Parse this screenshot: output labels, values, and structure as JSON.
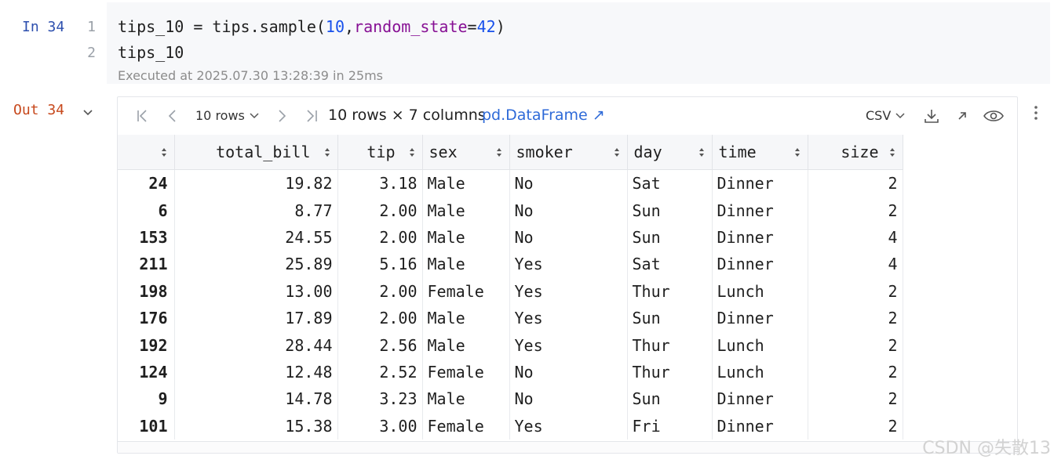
{
  "input_cell": {
    "prompt": "In 34",
    "line_numbers": [
      "1",
      "2"
    ],
    "line1": {
      "var": "tips_10 = tips.sample(",
      "arg1": "10",
      "comma": ",",
      "kw": "random_state",
      "eq": "=",
      "arg2": "42",
      "close": ")"
    },
    "line2": "tips_10",
    "executed": "Executed at 2025.07.30 13:28:39 in 25ms"
  },
  "output_cell": {
    "prompt": "Out 34",
    "toolbar": {
      "rows_select": "10 rows",
      "summary": "10 rows × 7 columns",
      "type_link": "pd.DataFrame ↗",
      "csv_select": "CSV",
      "icons": [
        "first-page-icon",
        "prev-page-icon",
        "next-page-icon",
        "last-page-icon",
        "download-icon",
        "open-external-icon",
        "eye-icon",
        "more-vertical-icon"
      ]
    },
    "table": {
      "columns": [
        "",
        "total_bill",
        "tip",
        "sex",
        "smoker",
        "day",
        "time",
        "size"
      ],
      "rows": [
        [
          "24",
          "19.82",
          "3.18",
          "Male",
          "No",
          "Sat",
          "Dinner",
          "2"
        ],
        [
          "6",
          "8.77",
          "2.00",
          "Male",
          "No",
          "Sun",
          "Dinner",
          "2"
        ],
        [
          "153",
          "24.55",
          "2.00",
          "Male",
          "No",
          "Sun",
          "Dinner",
          "4"
        ],
        [
          "211",
          "25.89",
          "5.16",
          "Male",
          "Yes",
          "Sat",
          "Dinner",
          "4"
        ],
        [
          "198",
          "13.00",
          "2.00",
          "Female",
          "Yes",
          "Thur",
          "Lunch",
          "2"
        ],
        [
          "176",
          "17.89",
          "2.00",
          "Male",
          "Yes",
          "Sun",
          "Dinner",
          "2"
        ],
        [
          "192",
          "28.44",
          "2.56",
          "Male",
          "Yes",
          "Thur",
          "Lunch",
          "2"
        ],
        [
          "124",
          "12.48",
          "2.52",
          "Female",
          "No",
          "Thur",
          "Lunch",
          "2"
        ],
        [
          "9",
          "14.78",
          "3.23",
          "Male",
          "No",
          "Sun",
          "Dinner",
          "2"
        ],
        [
          "101",
          "15.38",
          "3.00",
          "Female",
          "Yes",
          "Fri",
          "Dinner",
          "2"
        ]
      ]
    }
  },
  "watermark": "CSDN @失散13"
}
